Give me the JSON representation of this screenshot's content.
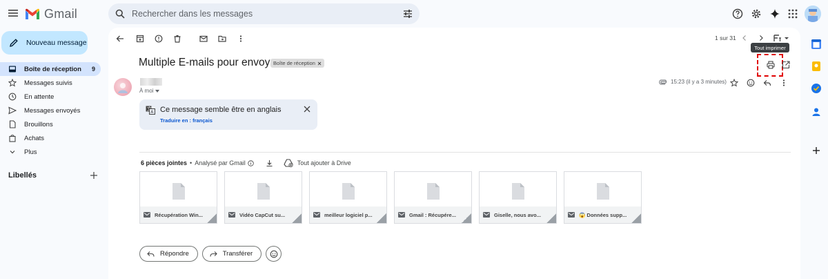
{
  "app": {
    "name": "Gmail"
  },
  "search": {
    "placeholder": "Rechercher dans les messages"
  },
  "compose": {
    "label": "Nouveau message"
  },
  "sidebar": {
    "items": [
      {
        "label": "Boîte de réception",
        "count": "9"
      },
      {
        "label": "Messages suivis"
      },
      {
        "label": "En attente"
      },
      {
        "label": "Messages envoyés"
      },
      {
        "label": "Brouillons"
      },
      {
        "label": "Achats"
      },
      {
        "label": "Plus"
      }
    ],
    "labels_heading": "Libellés"
  },
  "pager": {
    "text": "1 sur 31"
  },
  "tooltip": {
    "text": "Tout imprimer"
  },
  "email": {
    "subject": "Multiple E-mails pour envoyer",
    "label_badge": "Boîte de réception",
    "to": "À moi",
    "time": "15:23 (il y a 3 minutes)"
  },
  "translate": {
    "title": "Ce message semble être en anglais",
    "link": "Traduire en : français"
  },
  "attachments": {
    "count_label": "6 pièces jointes",
    "separator": "•",
    "scanned_label": "Analysé par Gmail",
    "add_all_label": "Tout ajouter à Drive",
    "items": [
      {
        "name": "Récupération Win..."
      },
      {
        "name": "Vidéo CapCut su..."
      },
      {
        "name": "meilleur logiciel p..."
      },
      {
        "name": "Gmail : Récupére..."
      },
      {
        "name": "Giselle, nous avo..."
      },
      {
        "name": "😱 Données supp..."
      }
    ]
  },
  "actions": {
    "reply": "Répondre",
    "forward": "Transférer"
  },
  "colors": {
    "accent": "#0b57d0",
    "compose_bg": "#c2e7ff",
    "active_nav": "#d3e3fd",
    "highlight": "#e00000"
  }
}
